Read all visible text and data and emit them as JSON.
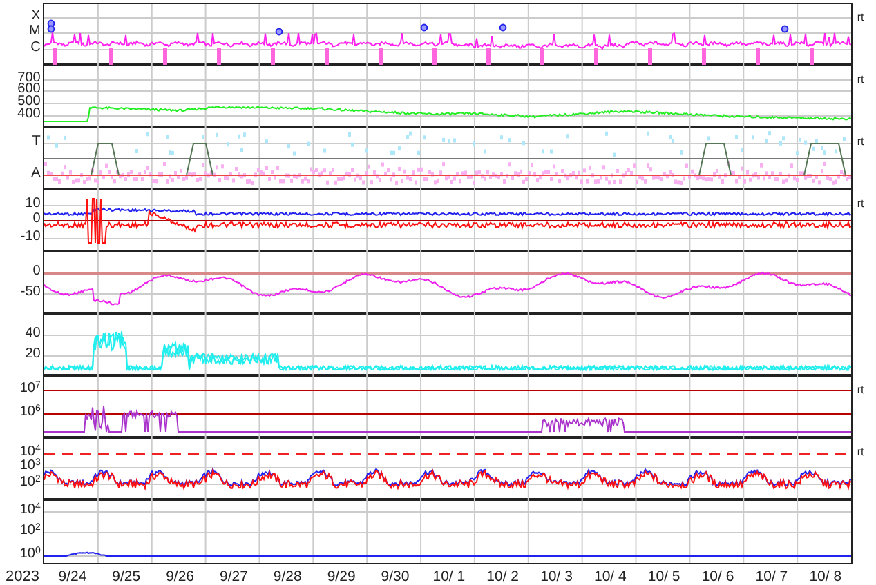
{
  "panels": [
    {
      "kind": "xray",
      "ticks": [
        "X",
        "M",
        "C"
      ],
      "note": "rt"
    },
    {
      "kind": "speed",
      "ticks": [
        "700",
        "600",
        "500",
        "400"
      ],
      "note": "rt"
    },
    {
      "kind": "mode",
      "ticks": [
        "T",
        "A"
      ],
      "note": "rt"
    },
    {
      "kind": "field",
      "ticks": [
        "10",
        "0",
        "-10"
      ],
      "note": "rt"
    },
    {
      "kind": "dst",
      "ticks": [
        "0",
        "-50"
      ]
    },
    {
      "kind": "density",
      "ticks": [
        "40",
        "20"
      ]
    },
    {
      "kind": "proton",
      "ticks": [
        "10$^{7}$",
        "10$^{6}$"
      ],
      "note": "rt"
    },
    {
      "kind": "electron",
      "ticks": [
        "10$^{4}$",
        "10$^{3}$",
        "10$^{2}$"
      ],
      "note": "rt"
    },
    {
      "kind": "flux",
      "ticks": [
        "10$^{4}$",
        "10$^{2}$",
        "10$^{0}$"
      ]
    }
  ],
  "time_axis": {
    "year": "2023",
    "days": [
      "9/24",
      "9/25",
      "9/26",
      "9/27",
      "9/28",
      "9/29",
      "9/30",
      "10/ 1",
      "10/ 2",
      "10/ 3",
      "10/ 4",
      "10/ 5",
      "10/ 6",
      "10/ 7",
      "10/ 8"
    ]
  }
}
